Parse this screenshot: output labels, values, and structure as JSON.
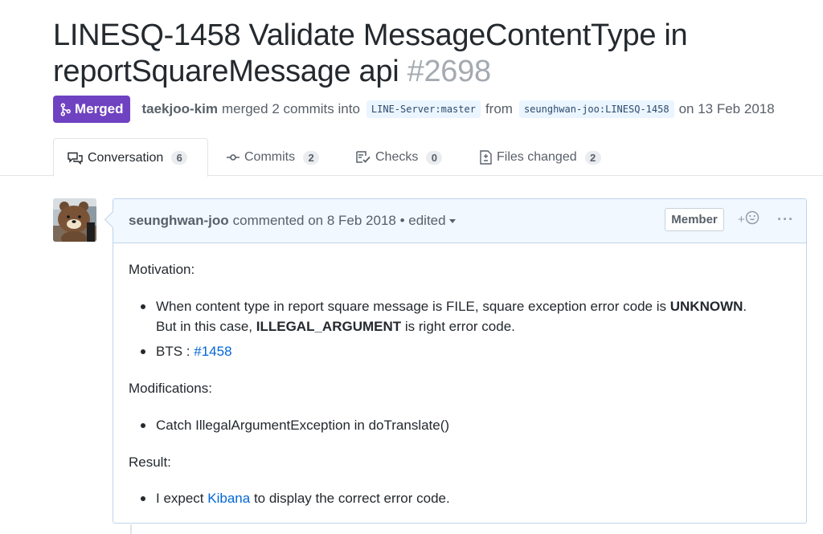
{
  "pr": {
    "title": "LINESQ-1458 Validate MessageContentType in reportSquareMessage api",
    "number": "#2698",
    "state": "Merged",
    "author": "taekjoo-kim",
    "merge_text": "merged 2 commits into",
    "base_branch": "LINE-Server:master",
    "from_text": "from",
    "head_branch": "seunghwan-joo:LINESQ-1458",
    "date_text": "on 13 Feb 2018"
  },
  "tabs": [
    {
      "label": "Conversation",
      "count": "6",
      "icon": "comment-discussion-icon"
    },
    {
      "label": "Commits",
      "count": "2",
      "icon": "git-commit-icon"
    },
    {
      "label": "Checks",
      "count": "0",
      "icon": "checklist-icon"
    },
    {
      "label": "Files changed",
      "count": "2",
      "icon": "file-diff-icon"
    }
  ],
  "comment": {
    "author": "seunghwan-joo",
    "meta": "commented on 8 Feb 2018 • edited",
    "role": "Member",
    "reaction_plus": "+",
    "more": "···",
    "motivation_heading": "Motivation:",
    "bullet1_a": "When content type in report square message is FILE, square exception error code is",
    "bullet1_b": "UNKNOWN",
    "bullet1_c": ".",
    "bullet1_d": "But in this case,",
    "bullet1_e": "ILLEGAL_ARGUMENT",
    "bullet1_f": "is right error code.",
    "bullet2_label": "BTS :",
    "bullet2_link": "#1458",
    "modifications_heading": "Modifications:",
    "bullet3": "Catch IllegalArgumentException in doTranslate()",
    "result_heading": "Result:",
    "bullet4_a": "I expect",
    "bullet4_link": "Kibana",
    "bullet4_b": "to display the correct error code."
  },
  "colors": {
    "merged": "#6f42c1",
    "link": "#0366d6",
    "header_bg": "#f1f8ff"
  }
}
